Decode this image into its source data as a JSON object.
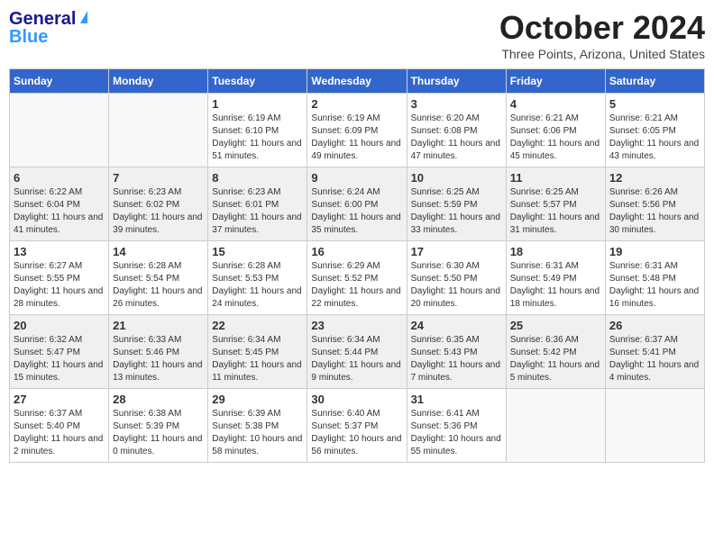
{
  "header": {
    "logo": {
      "line1": "General",
      "line2": "Blue"
    },
    "title": "October 2024",
    "location": "Three Points, Arizona, United States"
  },
  "days_of_week": [
    "Sunday",
    "Monday",
    "Tuesday",
    "Wednesday",
    "Thursday",
    "Friday",
    "Saturday"
  ],
  "weeks": [
    [
      {
        "day": "",
        "info": ""
      },
      {
        "day": "",
        "info": ""
      },
      {
        "day": "1",
        "info": "Sunrise: 6:19 AM\nSunset: 6:10 PM\nDaylight: 11 hours and 51 minutes."
      },
      {
        "day": "2",
        "info": "Sunrise: 6:19 AM\nSunset: 6:09 PM\nDaylight: 11 hours and 49 minutes."
      },
      {
        "day": "3",
        "info": "Sunrise: 6:20 AM\nSunset: 6:08 PM\nDaylight: 11 hours and 47 minutes."
      },
      {
        "day": "4",
        "info": "Sunrise: 6:21 AM\nSunset: 6:06 PM\nDaylight: 11 hours and 45 minutes."
      },
      {
        "day": "5",
        "info": "Sunrise: 6:21 AM\nSunset: 6:05 PM\nDaylight: 11 hours and 43 minutes."
      }
    ],
    [
      {
        "day": "6",
        "info": "Sunrise: 6:22 AM\nSunset: 6:04 PM\nDaylight: 11 hours and 41 minutes."
      },
      {
        "day": "7",
        "info": "Sunrise: 6:23 AM\nSunset: 6:02 PM\nDaylight: 11 hours and 39 minutes."
      },
      {
        "day": "8",
        "info": "Sunrise: 6:23 AM\nSunset: 6:01 PM\nDaylight: 11 hours and 37 minutes."
      },
      {
        "day": "9",
        "info": "Sunrise: 6:24 AM\nSunset: 6:00 PM\nDaylight: 11 hours and 35 minutes."
      },
      {
        "day": "10",
        "info": "Sunrise: 6:25 AM\nSunset: 5:59 PM\nDaylight: 11 hours and 33 minutes."
      },
      {
        "day": "11",
        "info": "Sunrise: 6:25 AM\nSunset: 5:57 PM\nDaylight: 11 hours and 31 minutes."
      },
      {
        "day": "12",
        "info": "Sunrise: 6:26 AM\nSunset: 5:56 PM\nDaylight: 11 hours and 30 minutes."
      }
    ],
    [
      {
        "day": "13",
        "info": "Sunrise: 6:27 AM\nSunset: 5:55 PM\nDaylight: 11 hours and 28 minutes."
      },
      {
        "day": "14",
        "info": "Sunrise: 6:28 AM\nSunset: 5:54 PM\nDaylight: 11 hours and 26 minutes."
      },
      {
        "day": "15",
        "info": "Sunrise: 6:28 AM\nSunset: 5:53 PM\nDaylight: 11 hours and 24 minutes."
      },
      {
        "day": "16",
        "info": "Sunrise: 6:29 AM\nSunset: 5:52 PM\nDaylight: 11 hours and 22 minutes."
      },
      {
        "day": "17",
        "info": "Sunrise: 6:30 AM\nSunset: 5:50 PM\nDaylight: 11 hours and 20 minutes."
      },
      {
        "day": "18",
        "info": "Sunrise: 6:31 AM\nSunset: 5:49 PM\nDaylight: 11 hours and 18 minutes."
      },
      {
        "day": "19",
        "info": "Sunrise: 6:31 AM\nSunset: 5:48 PM\nDaylight: 11 hours and 16 minutes."
      }
    ],
    [
      {
        "day": "20",
        "info": "Sunrise: 6:32 AM\nSunset: 5:47 PM\nDaylight: 11 hours and 15 minutes."
      },
      {
        "day": "21",
        "info": "Sunrise: 6:33 AM\nSunset: 5:46 PM\nDaylight: 11 hours and 13 minutes."
      },
      {
        "day": "22",
        "info": "Sunrise: 6:34 AM\nSunset: 5:45 PM\nDaylight: 11 hours and 11 minutes."
      },
      {
        "day": "23",
        "info": "Sunrise: 6:34 AM\nSunset: 5:44 PM\nDaylight: 11 hours and 9 minutes."
      },
      {
        "day": "24",
        "info": "Sunrise: 6:35 AM\nSunset: 5:43 PM\nDaylight: 11 hours and 7 minutes."
      },
      {
        "day": "25",
        "info": "Sunrise: 6:36 AM\nSunset: 5:42 PM\nDaylight: 11 hours and 5 minutes."
      },
      {
        "day": "26",
        "info": "Sunrise: 6:37 AM\nSunset: 5:41 PM\nDaylight: 11 hours and 4 minutes."
      }
    ],
    [
      {
        "day": "27",
        "info": "Sunrise: 6:37 AM\nSunset: 5:40 PM\nDaylight: 11 hours and 2 minutes."
      },
      {
        "day": "28",
        "info": "Sunrise: 6:38 AM\nSunset: 5:39 PM\nDaylight: 11 hours and 0 minutes."
      },
      {
        "day": "29",
        "info": "Sunrise: 6:39 AM\nSunset: 5:38 PM\nDaylight: 10 hours and 58 minutes."
      },
      {
        "day": "30",
        "info": "Sunrise: 6:40 AM\nSunset: 5:37 PM\nDaylight: 10 hours and 56 minutes."
      },
      {
        "day": "31",
        "info": "Sunrise: 6:41 AM\nSunset: 5:36 PM\nDaylight: 10 hours and 55 minutes."
      },
      {
        "day": "",
        "info": ""
      },
      {
        "day": "",
        "info": ""
      }
    ]
  ]
}
